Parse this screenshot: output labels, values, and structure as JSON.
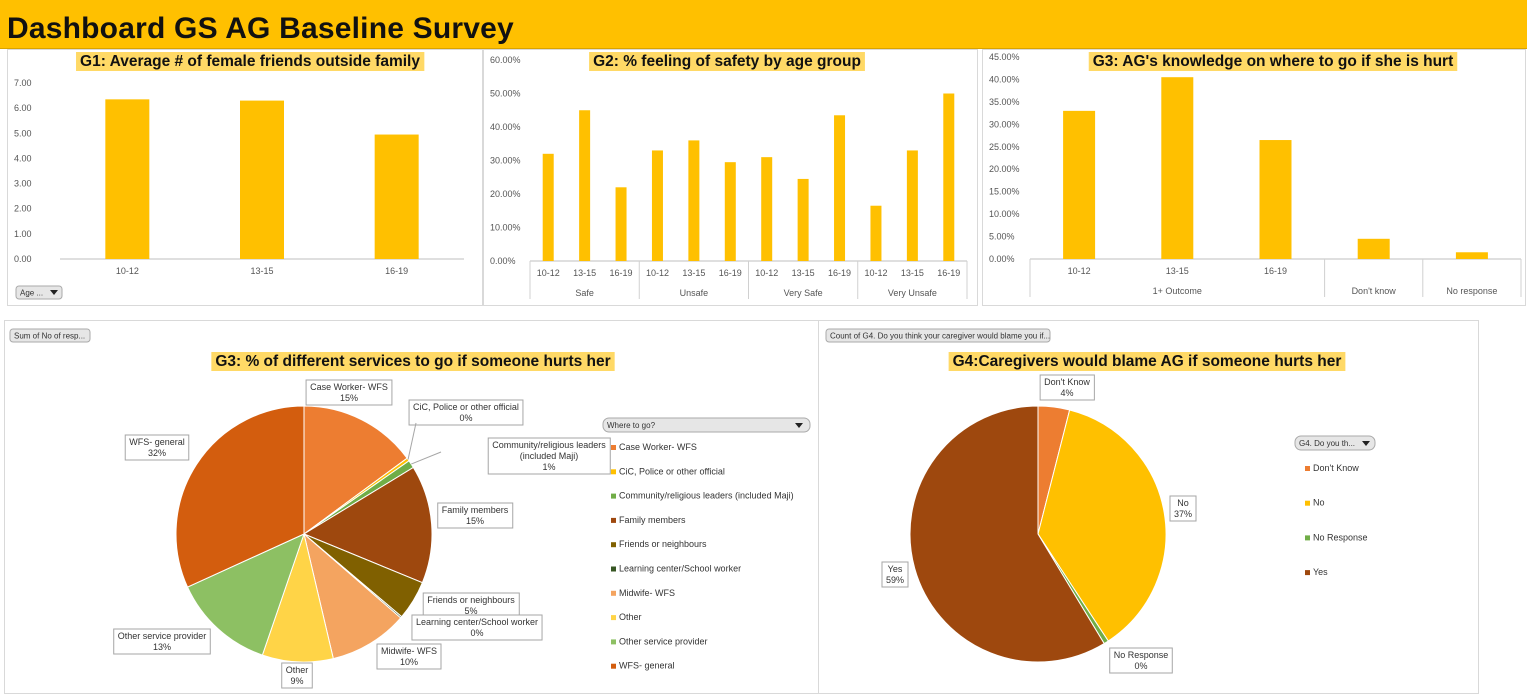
{
  "dashboard_title": "Dashboard GS AG Baseline Survey",
  "colors": {
    "banner": "#FFC000",
    "bar": "#FFC000",
    "title_bg": "#FFD966",
    "pie_g3": [
      "#ED7D31",
      "#FFC000",
      "#70AD47",
      "#9E480E",
      "#806000",
      "#375623",
      "#F4A460",
      "#FFD447",
      "#8DC063",
      "#D35D0E"
    ],
    "pie_g4": [
      "#ED7D31",
      "#FFC000",
      "#70AD47",
      "#9E480E"
    ]
  },
  "filters": {
    "g1_filter": "Age ...",
    "g3_pie_field": "Sum of No of resp...",
    "g4_pie_field": "Count of G4. Do you think your caregiver would blame you if...",
    "g3_legend_title": "Where to go?",
    "g4_legend_title": "G4. Do you th..."
  },
  "chart_data": [
    {
      "type": "bar",
      "title": "G1: Average # of female friends outside family",
      "categories": [
        "10-12",
        "13-15",
        "16-19"
      ],
      "values": [
        6.35,
        6.3,
        4.95
      ],
      "ylim": [
        0,
        7
      ],
      "yticks": [
        "0.00",
        "1.00",
        "2.00",
        "3.00",
        "4.00",
        "5.00",
        "6.00",
        "7.00"
      ],
      "grid": false
    },
    {
      "type": "bar",
      "title": "G2: % feeling of safety by age group",
      "groups": [
        {
          "name": "Safe",
          "categories": [
            "10-12",
            "13-15",
            "16-19"
          ],
          "values": [
            32,
            45,
            22
          ]
        },
        {
          "name": "Unsafe",
          "categories": [
            "10-12",
            "13-15",
            "16-19"
          ],
          "values": [
            33,
            36,
            29.5
          ]
        },
        {
          "name": "Very Safe",
          "categories": [
            "10-12",
            "13-15",
            "16-19"
          ],
          "values": [
            31,
            24.5,
            43.5
          ]
        },
        {
          "name": "Very Unsafe",
          "categories": [
            "10-12",
            "13-15",
            "16-19"
          ],
          "values": [
            16.5,
            33,
            50
          ]
        }
      ],
      "ylim": [
        0,
        60
      ],
      "yticks": [
        "0.00%",
        "10.00%",
        "20.00%",
        "30.00%",
        "40.00%",
        "50.00%",
        "60.00%"
      ],
      "grid": false
    },
    {
      "type": "bar",
      "title": "G3: AG's knowledge on where to go if she is hurt",
      "groups": [
        {
          "name": "1+ Outcome",
          "categories": [
            "10-12",
            "13-15",
            "16-19"
          ],
          "values": [
            33,
            40.5,
            26.5
          ]
        },
        {
          "name": "Don't know",
          "categories": [
            ""
          ],
          "values": [
            4.5
          ]
        },
        {
          "name": "No response",
          "categories": [
            ""
          ],
          "values": [
            1.5
          ]
        }
      ],
      "ylim": [
        0,
        45
      ],
      "yticks": [
        "0.00%",
        "5.00%",
        "10.00%",
        "15.00%",
        "20.00%",
        "25.00%",
        "30.00%",
        "35.00%",
        "40.00%",
        "45.00%"
      ],
      "grid": false
    },
    {
      "type": "pie",
      "title": "G3: % of different services to go if someone hurts her",
      "slices": [
        {
          "name": "Case Worker- WFS",
          "value": 15,
          "label": "15%"
        },
        {
          "name": "CiC, Police or other official",
          "value": 0.4,
          "label": "0%"
        },
        {
          "name": "Community/religious leaders (included Maji)",
          "value": 1,
          "label": "1%"
        },
        {
          "name": "Family members",
          "value": 15,
          "label": "15%"
        },
        {
          "name": "Friends or neighbours",
          "value": 5,
          "label": "5%"
        },
        {
          "name": "Learning center/School worker",
          "value": 0.2,
          "label": "0%"
        },
        {
          "name": "Midwife- WFS",
          "value": 10,
          "label": "10%"
        },
        {
          "name": "Other",
          "value": 9,
          "label": "9%"
        },
        {
          "name": "Other service provider",
          "value": 13,
          "label": "13%"
        },
        {
          "name": "WFS- general",
          "value": 32,
          "label": "32%"
        }
      ],
      "data_labels": [
        {
          "name": "Case Worker- WFS",
          "pct": "15%"
        },
        {
          "name": "CiC, Police or other official",
          "pct": "0%"
        },
        {
          "name": "Community/religious  leaders\n(included  Maji)",
          "pct": "1%"
        },
        {
          "name": "Family members",
          "pct": "15%"
        },
        {
          "name": "Friends  or neighbours",
          "pct": "5%"
        },
        {
          "name": "Learning center/School  worker",
          "pct": "0%"
        },
        {
          "name": "Midwife-  WFS",
          "pct": "10%"
        },
        {
          "name": "Other",
          "pct": "9%"
        },
        {
          "name": "Other service provider",
          "pct": "13%"
        },
        {
          "name": "WFS- general",
          "pct": "32%"
        }
      ],
      "legend": "right"
    },
    {
      "type": "pie",
      "title": "G4:Caregivers would blame AG  if someone hurts her",
      "slices": [
        {
          "name": "Don't Know",
          "value": 4,
          "label": "4%"
        },
        {
          "name": "No",
          "value": 37,
          "label": "37%"
        },
        {
          "name": "No Response",
          "value": 0.6,
          "label": "0%"
        },
        {
          "name": "Yes",
          "value": 59,
          "label": "59%"
        }
      ],
      "legend": "right"
    }
  ]
}
